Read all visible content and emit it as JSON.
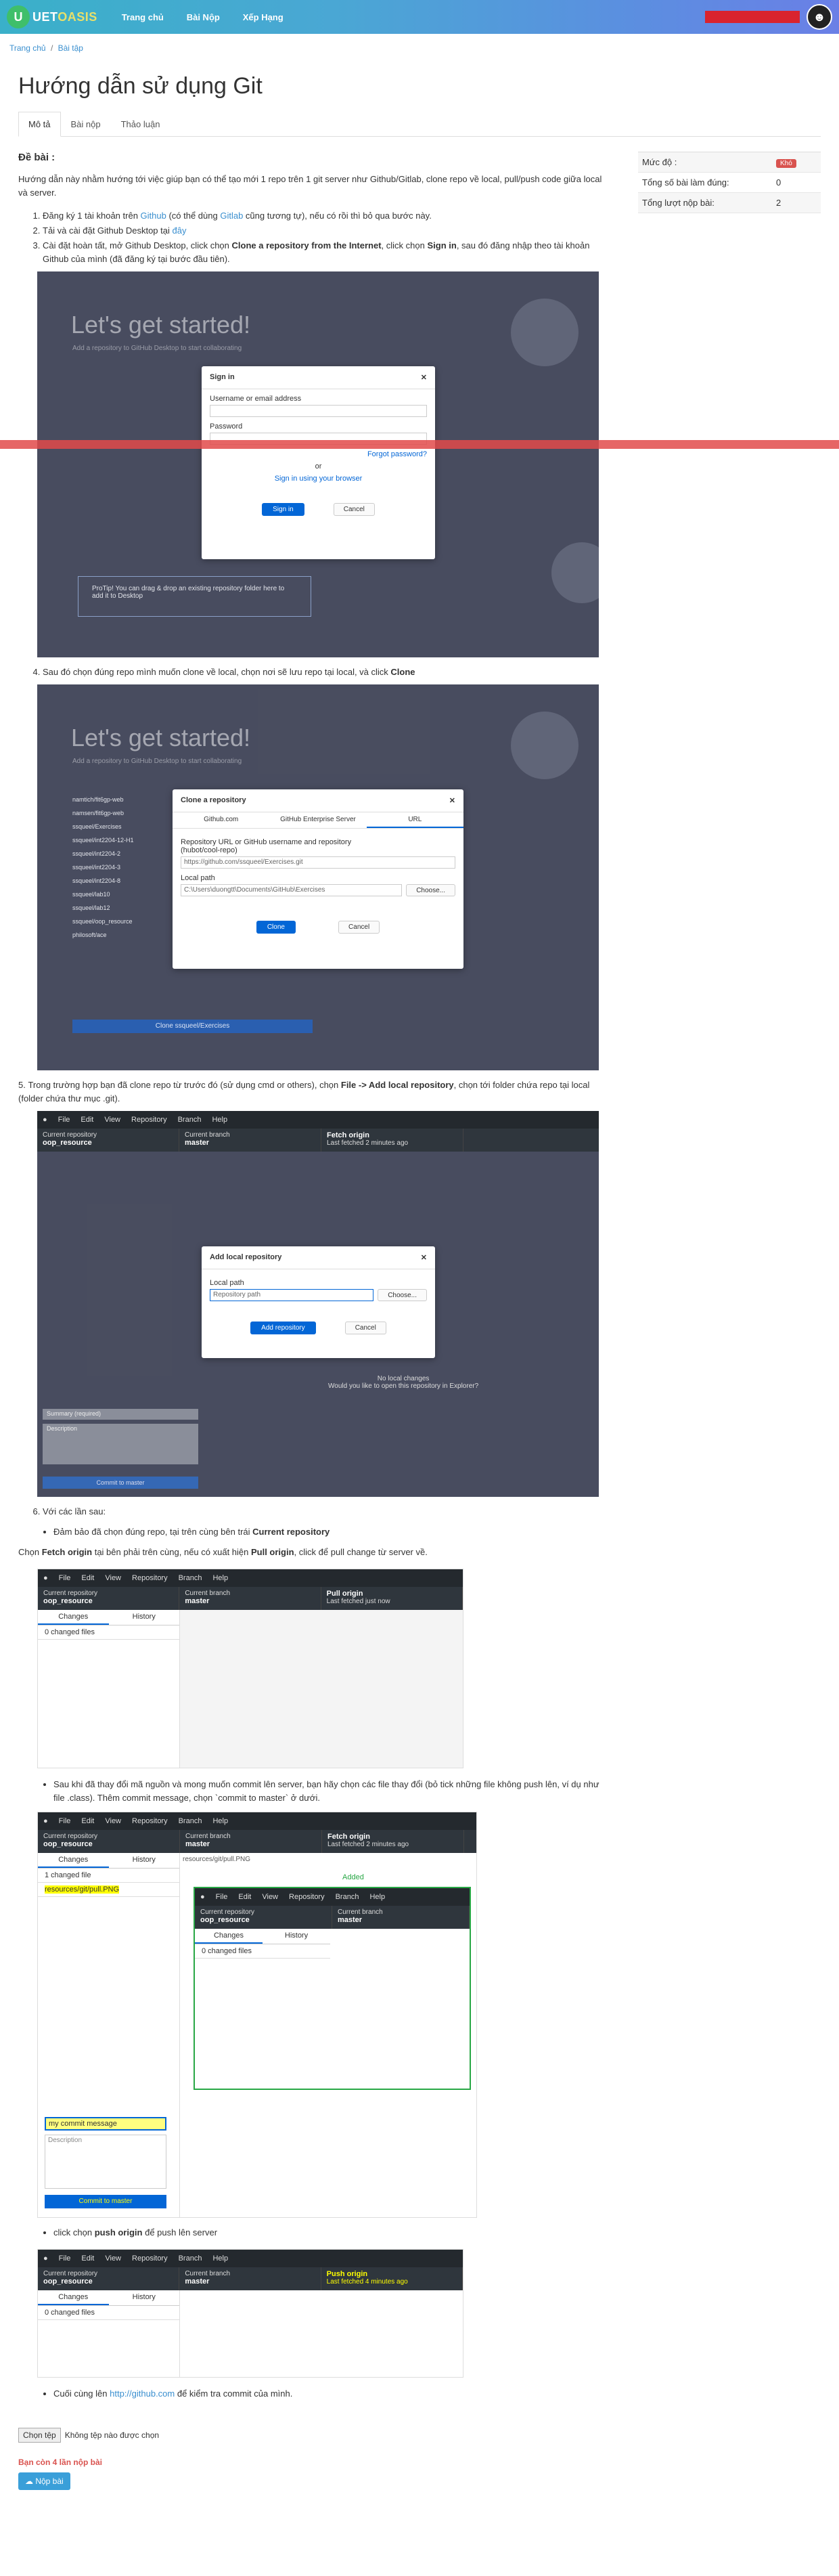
{
  "header": {
    "logo_mark": "U",
    "logo_text_a": "UET",
    "logo_text_b": "OASIS",
    "nav": [
      "Trang chủ",
      "Bài Nộp",
      "Xếp Hạng"
    ]
  },
  "breadcrumb": {
    "home": "Trang chủ",
    "sep": "/",
    "current": "Bài tập"
  },
  "page_title": "Hướng dẫn sử dụng Git",
  "tabs": [
    "Mô tả",
    "Bài nộp",
    "Thảo luận"
  ],
  "sidebar": {
    "rows": [
      {
        "label": "Mức độ :",
        "value": "Khó"
      },
      {
        "label": "Tổng số bài làm đúng:",
        "value": "0"
      },
      {
        "label": "Tổng lượt nộp bài:",
        "value": "2"
      }
    ]
  },
  "body": {
    "section_title": "Đề bài :",
    "intro": "Hướng dẫn này nhằm hướng tới việc giúp bạn có thể tạo mới 1 repo trên 1 git server như Github/Gitlab, clone repo về local, pull/push code giữa local và server.",
    "step1_a": "Đăng ký 1 tài khoản trên ",
    "step1_link1": "Github",
    "step1_b": " (có thể dùng ",
    "step1_link2": "Gitlab",
    "step1_c": " cũng tương tự), nếu có rồi thì bỏ qua bước này.",
    "step2_a": "Tải và cài đặt Github Desktop tại ",
    "step2_link": "đây",
    "step3_a": "Cài đặt hoàn tất, mở Github Desktop, click chọn ",
    "step3_b": "Clone a repository from the Internet",
    "step3_c": ", click chọn ",
    "step3_d": "Sign in",
    "step3_e": ", sau đó đăng nhập theo tài khoản Github của mình (đã đăng ký tại bước đầu tiên).",
    "step4_a": "Sau đó chọn đúng repo mình muốn clone về local, chọn nơi sẽ lưu repo tại local, và click ",
    "step4_b": "Clone",
    "step5_a": "Trong trường hợp bạn đã clone repo từ trước đó (sử dụng cmd or others), chọn ",
    "step5_b": "File -> Add local repository",
    "step5_c": ", chọn tới folder chứa repo tại local (folder chứa thư mục .git).",
    "step6": "Với các lần sau:",
    "b1_a": "Đảm bảo đã chọn đúng repo, tại trên cùng bên trái ",
    "b1_b": "Current repository",
    "fetch_a": "Chọn ",
    "fetch_b": "Fetch origin",
    "fetch_c": " tại bên phải trên cùng, nếu có xuất hiện ",
    "fetch_d": "Pull origin",
    "fetch_e": ", click để pull change từ server về.",
    "b2": "Sau khi đã thay đổi mã nguồn và mong muốn commit lên server, bạn hãy chọn các file thay đổi (bỏ tick những file không push lên, ví dụ như file .class). Thêm commit message, chọn `commit to master` ở dưới.",
    "b3_a": "click chọn ",
    "b3_b": "push origin",
    "b3_c": " để push lên server",
    "b4_a": "Cuối cùng lên ",
    "b4_link": "http://github.com",
    "b4_b": " để kiểm tra commit của mình."
  },
  "shots": {
    "lets": "Let's get started!",
    "lets_sub": "Add a repository to GitHub Desktop to start collaborating",
    "signin": {
      "title": "Sign in",
      "user_label": "Username or email address",
      "pass_label": "Password",
      "forgot": "Forgot password?",
      "or": "or",
      "browser": "Sign in using your browser",
      "btn": "Sign in",
      "cancel": "Cancel"
    },
    "clone": {
      "title": "Clone a repository",
      "tabs": [
        "Github.com",
        "GitHub Enterprise Server",
        "URL"
      ],
      "url_label": "Repository URL or GitHub username and repository",
      "url_hint": "(hubot/cool-repo)",
      "url_value": "https://github.com/ssqueel/Exercises.git",
      "local_label": "Local path",
      "local_value": "C:\\Users\\duongtt\\Documents\\GitHub\\Exercises",
      "choose": "Choose...",
      "btn": "Clone",
      "cancel": "Cancel",
      "repos": [
        "namtich/fit6gp-web",
        "namsen/fit6gp-web",
        "ssqueel/Exercises",
        "ssqueel/int2204-12-H1",
        "ssqueel/int2204-2",
        "ssqueel/int2204-3",
        "ssqueel/int2204-8",
        "ssqueel/lab10",
        "ssqueel/lab12",
        "ssqueel/oop_resource",
        "philosoft/ace"
      ],
      "clone_btn": "Clone ssqueel/Exercises"
    },
    "menu": [
      "File",
      "Edit",
      "View",
      "Repository",
      "Branch",
      "Help"
    ],
    "cur_repo": "Current repository",
    "repo_name": "oop_resource",
    "cur_branch": "Current branch",
    "branch_name": "master",
    "fetch": "Fetch origin",
    "fetch_sub": "Last fetched 2 minutes ago",
    "fetch_sub2": "Last fetched just now",
    "pull": "Pull origin",
    "push": "Push origin",
    "push_sub": "Last fetched 4 minutes ago",
    "changes": "Changes",
    "history": "History",
    "zero_files": "0 changed files",
    "one_file": "1 changed file",
    "file": "resources/git/pull.PNG",
    "added": "Added",
    "addlocal": {
      "title": "Add local repository",
      "label": "Local path",
      "placeholder": "Repository path",
      "choose": "Choose...",
      "btn": "Add repository",
      "cancel": "Cancel"
    },
    "summary": "Summary (required)",
    "description": "Description",
    "commit_btn": "Commit to master",
    "commit_msg": "my commit message",
    "protip": "ProTip! You can drag & drop an existing repository folder here to add it to Desktop",
    "no_local": "No local changes",
    "open_in": "Would you like to open this repository in Explorer?"
  },
  "form": {
    "choose_file": "Chọn tệp",
    "no_file": "Không tệp nào được chọn",
    "remain": "Bạn còn 4 lần nộp bài",
    "submit": "☁ Nộp bài"
  }
}
